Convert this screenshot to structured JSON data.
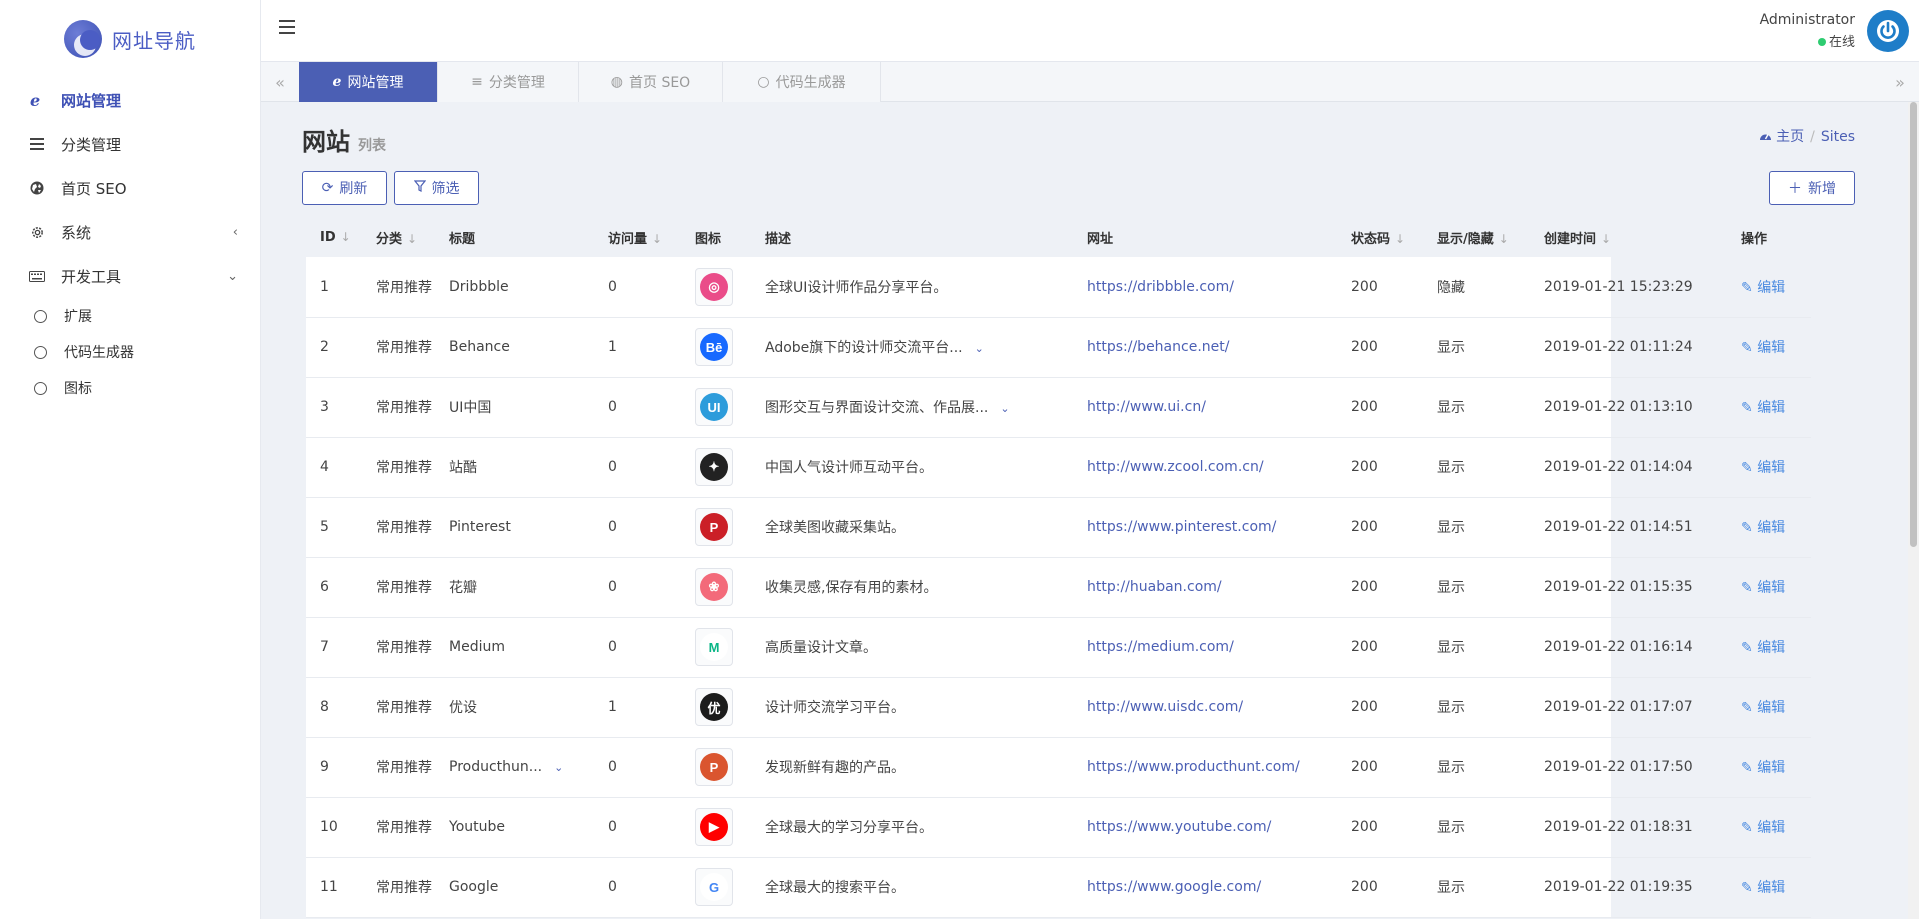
{
  "brand": {
    "name": "网址导航"
  },
  "sidebar": {
    "items": [
      {
        "label": "网站管理",
        "icon": "ie-icon",
        "active": true
      },
      {
        "label": "分类管理",
        "icon": "list-icon"
      },
      {
        "label": "首页 SEO",
        "icon": "globe-icon"
      },
      {
        "label": "系统",
        "icon": "gear-icon",
        "chevron": "‹"
      },
      {
        "label": "开发工具",
        "icon": "keyboard-icon",
        "chevron": "⌄"
      }
    ],
    "subitems": [
      {
        "label": "扩展"
      },
      {
        "label": "代码生成器"
      },
      {
        "label": "图标"
      }
    ]
  },
  "user": {
    "name": "Administrator",
    "status": "在线"
  },
  "tabs": [
    {
      "label": "网站管理",
      "active": true
    },
    {
      "label": "分类管理"
    },
    {
      "label": "首页 SEO"
    },
    {
      "label": "代码生成器"
    }
  ],
  "page": {
    "title": "网站",
    "subtitle": "列表"
  },
  "breadcrumb": {
    "home": "主页",
    "current": "Sites"
  },
  "toolbar": {
    "refresh": "刷新",
    "filter": "筛选",
    "add": "新增"
  },
  "table": {
    "columns": [
      "ID",
      "分类",
      "标题",
      "访问量",
      "图标",
      "描述",
      "网址",
      "状态码",
      "显示/隐藏",
      "创建时间",
      "操作"
    ],
    "edit_label": "编辑",
    "rows": [
      {
        "id": "1",
        "category": "常用推荐",
        "title": "Dribbble",
        "visits": "0",
        "icon": "dribbble-logo",
        "desc": "全球UI设计师作品分享平台。",
        "url": "https://dribbble.com/",
        "status": "200",
        "visible": "隐藏",
        "created": "2019-01-21 15:23:29"
      },
      {
        "id": "2",
        "category": "常用推荐",
        "title": "Behance",
        "visits": "1",
        "icon": "behance-logo",
        "desc": "Adobe旗下的设计师交流平台...",
        "url": "https://behance.net/",
        "status": "200",
        "visible": "显示",
        "created": "2019-01-22 01:11:24"
      },
      {
        "id": "3",
        "category": "常用推荐",
        "title": "UI中国",
        "visits": "0",
        "icon": "uichina-logo",
        "desc": "图形交互与界面设计交流、作品展...",
        "url": "http://www.ui.cn/",
        "status": "200",
        "visible": "显示",
        "created": "2019-01-22 01:13:10"
      },
      {
        "id": "4",
        "category": "常用推荐",
        "title": "站酷",
        "visits": "0",
        "icon": "zcool-logo",
        "desc": "中国人气设计师互动平台。",
        "url": "http://www.zcool.com.cn/",
        "status": "200",
        "visible": "显示",
        "created": "2019-01-22 01:14:04"
      },
      {
        "id": "5",
        "category": "常用推荐",
        "title": "Pinterest",
        "visits": "0",
        "icon": "pinterest-logo",
        "desc": "全球美图收藏采集站。",
        "url": "https://www.pinterest.com/",
        "status": "200",
        "visible": "显示",
        "created": "2019-01-22 01:14:51"
      },
      {
        "id": "6",
        "category": "常用推荐",
        "title": "花瓣",
        "visits": "0",
        "icon": "huaban-logo",
        "desc": "收集灵感,保存有用的素材。",
        "url": "http://huaban.com/",
        "status": "200",
        "visible": "显示",
        "created": "2019-01-22 01:15:35"
      },
      {
        "id": "7",
        "category": "常用推荐",
        "title": "Medium",
        "visits": "0",
        "icon": "medium-logo",
        "desc": "高质量设计文章。",
        "url": "https://medium.com/",
        "status": "200",
        "visible": "显示",
        "created": "2019-01-22 01:16:14"
      },
      {
        "id": "8",
        "category": "常用推荐",
        "title": "优设",
        "visits": "1",
        "icon": "uisdc-logo",
        "desc": "设计师交流学习平台。",
        "url": "http://www.uisdc.com/",
        "status": "200",
        "visible": "显示",
        "created": "2019-01-22 01:17:07"
      },
      {
        "id": "9",
        "category": "常用推荐",
        "title": "Producthun...",
        "visits": "0",
        "icon": "producthunt-logo",
        "desc": "发现新鲜有趣的产品。",
        "url": "https://www.producthunt.com/",
        "status": "200",
        "visible": "显示",
        "created": "2019-01-22 01:17:50"
      },
      {
        "id": "10",
        "category": "常用推荐",
        "title": "Youtube",
        "visits": "0",
        "icon": "youtube-logo",
        "desc": "全球最大的学习分享平台。",
        "url": "https://www.youtube.com/",
        "status": "200",
        "visible": "显示",
        "created": "2019-01-22 01:18:31"
      },
      {
        "id": "11",
        "category": "常用推荐",
        "title": "Google",
        "visits": "0",
        "icon": "google-logo",
        "desc": "全球最大的搜索平台。",
        "url": "https://www.google.com/",
        "status": "200",
        "visible": "显示",
        "created": "2019-01-22 01:19:35"
      }
    ]
  }
}
